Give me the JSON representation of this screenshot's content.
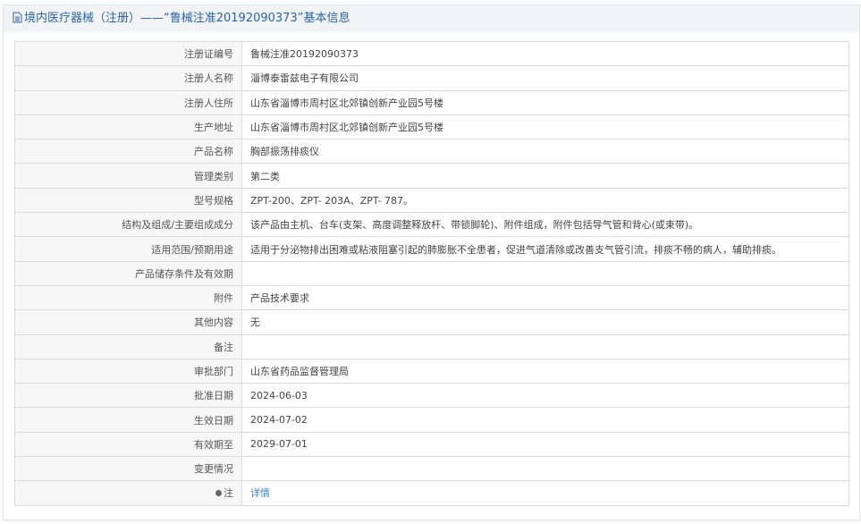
{
  "header": {
    "title": "境内医疗器械（注册）——“鲁械注准20192090373”基本信息"
  },
  "rows": [
    {
      "label": "注册证编号",
      "value": "鲁械注准20192090373"
    },
    {
      "label": "注册人名称",
      "value": "淄博泰雷兹电子有限公司"
    },
    {
      "label": "注册人住所",
      "value": "山东省淄博市周村区北郊镇创新产业园5号楼"
    },
    {
      "label": "生产地址",
      "value": "山东省淄博市周村区北郊镇创新产业园5号楼"
    },
    {
      "label": "产品名称",
      "value": "胸部振荡排痰仪"
    },
    {
      "label": "管理类别",
      "value": "第二类"
    },
    {
      "label": "型号规格",
      "value": "ZPT-200、ZPT- 203A、ZPT- 787。"
    },
    {
      "label": "结构及组成/主要组成成分",
      "value": "该产品由主机、台车(支架、高度调整释放杆、带锁脚轮)、附件组成，附件包括导气管和背心(或束带)。"
    },
    {
      "label": "适用范围/预期用途",
      "value": "适用于分泌物排出困难或粘液阻塞引起的肺膨胀不全患者，促进气道清除或改善支气管引流，排痰不畅的病人，辅助排痰。"
    },
    {
      "label": "产品储存条件及有效期",
      "value": ""
    },
    {
      "label": "附件",
      "value": "产品技术要求"
    },
    {
      "label": "其他内容",
      "value": "无"
    },
    {
      "label": "备注",
      "value": ""
    },
    {
      "label": "审批部门",
      "value": "山东省药品监督管理局"
    },
    {
      "label": "批准日期",
      "value": "2024-06-03"
    },
    {
      "label": "生效日期",
      "value": "2024-07-02"
    },
    {
      "label": "有效期至",
      "value": "2029-07-01"
    },
    {
      "label": "变更情况",
      "value": ""
    }
  ],
  "note": {
    "label": "注",
    "link": "详情"
  }
}
